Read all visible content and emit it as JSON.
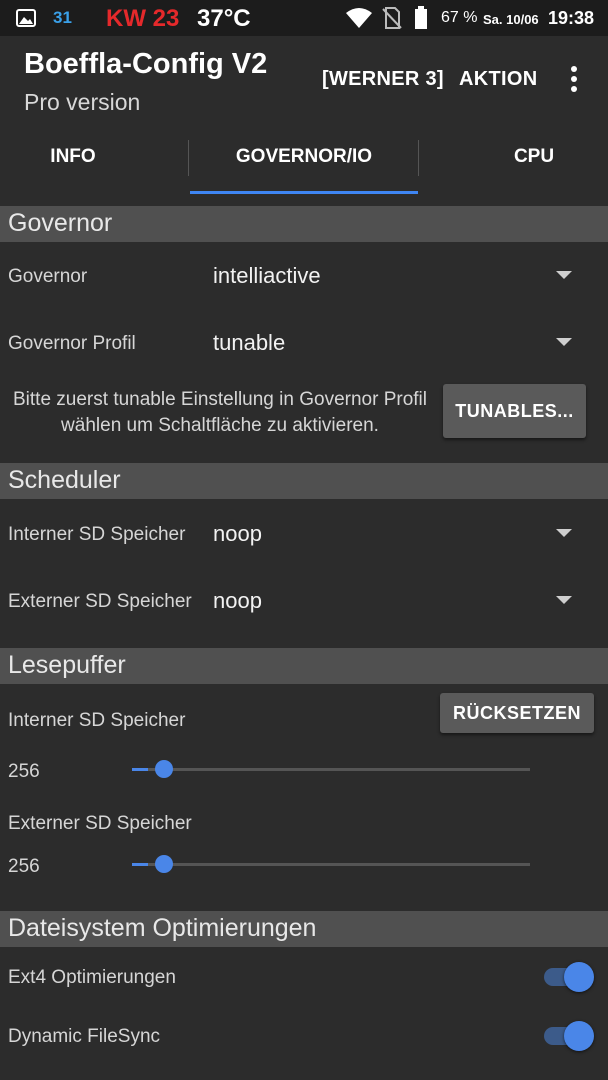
{
  "status_bar": {
    "notification_count": "31",
    "week": "KW 23",
    "temperature": "37°C",
    "battery_percent": "67 %",
    "date": "Sa. 10/06",
    "time": "19:38",
    "icons": [
      "image-icon",
      "wifi-icon",
      "no-sim-icon",
      "battery-icon"
    ]
  },
  "app_bar": {
    "title": "Boeffla-Config V2",
    "subtitle": "Pro version",
    "profile_action": "[WERNER 3]",
    "action_label": "AKTION"
  },
  "tabs": [
    {
      "label": "INFO",
      "active": false
    },
    {
      "label": "GOVERNOR/IO",
      "active": true
    },
    {
      "label": "CPU",
      "active": false
    }
  ],
  "governor_section": {
    "title": "Governor",
    "governor_label": "Governor",
    "governor_value": "intelliactive",
    "profile_label": "Governor Profil",
    "profile_value": "tunable",
    "hint": "Bitte zuerst tunable Einstellung in Governor Profil wählen um Schaltfläche zu aktivieren.",
    "tunables_button": "TUNABLES..."
  },
  "scheduler_section": {
    "title": "Scheduler",
    "internal_label": "Interner SD Speicher",
    "internal_value": "noop",
    "external_label": "Externer SD Speicher",
    "external_value": "noop"
  },
  "readahead_section": {
    "title": "Lesepuffer",
    "reset_button": "RÜCKSETZEN",
    "internal_label": "Interner SD Speicher",
    "internal_value": "256",
    "internal_level": 0.04,
    "external_label": "Externer SD Speicher",
    "external_value": "256",
    "external_level": 0.04
  },
  "fs_section": {
    "title": "Dateisystem Optimierungen",
    "ext4_label": "Ext4 Optimierungen",
    "ext4_on": true,
    "filesync_label": "Dynamic FileSync",
    "filesync_on": true
  },
  "colors": {
    "accent": "#4a86e8",
    "background": "#2c2c2c",
    "section_header": "#505050",
    "week_red": "#e5292b"
  }
}
